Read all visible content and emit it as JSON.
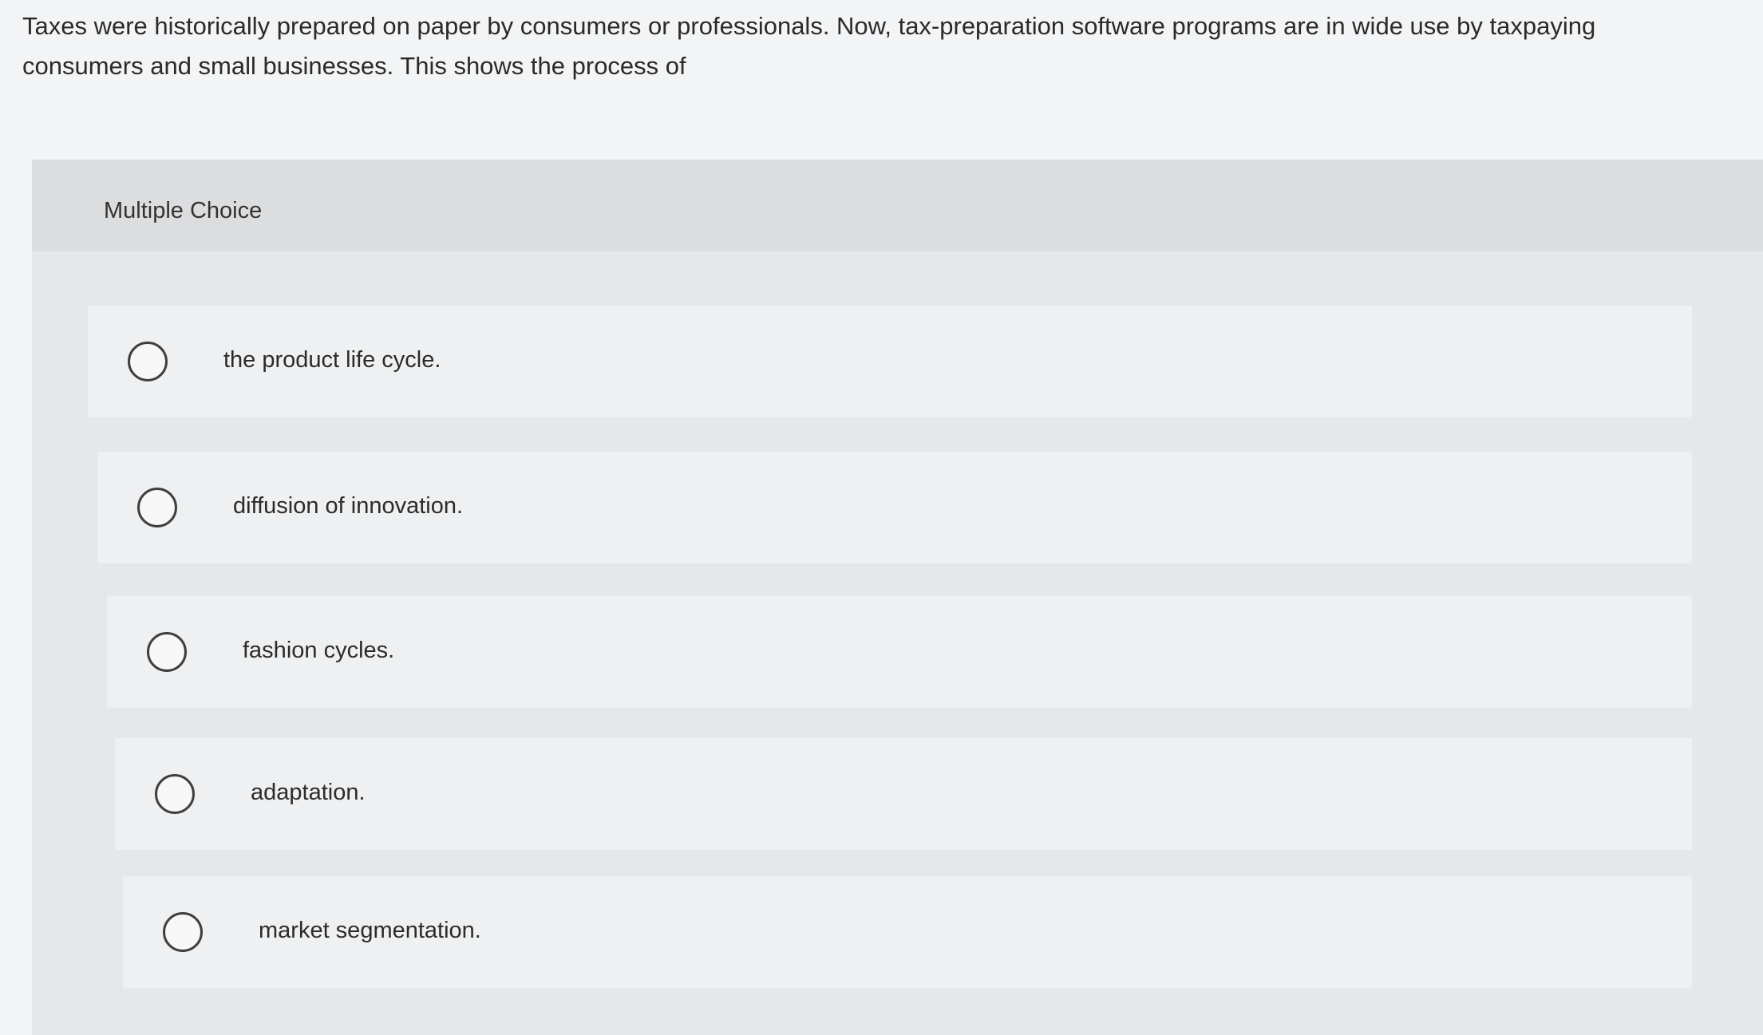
{
  "question": {
    "text": "Taxes were historically prepared on paper by consumers or professionals. Now, tax-preparation software programs are in wide use by taxpaying consumers and small businesses. This shows the process of"
  },
  "multiple_choice": {
    "label": "Multiple Choice",
    "options": [
      {
        "label": "the product life cycle."
      },
      {
        "label": "diffusion of innovation."
      },
      {
        "label": "fashion cycles."
      },
      {
        "label": "adaptation."
      },
      {
        "label": "market segmentation."
      }
    ]
  }
}
